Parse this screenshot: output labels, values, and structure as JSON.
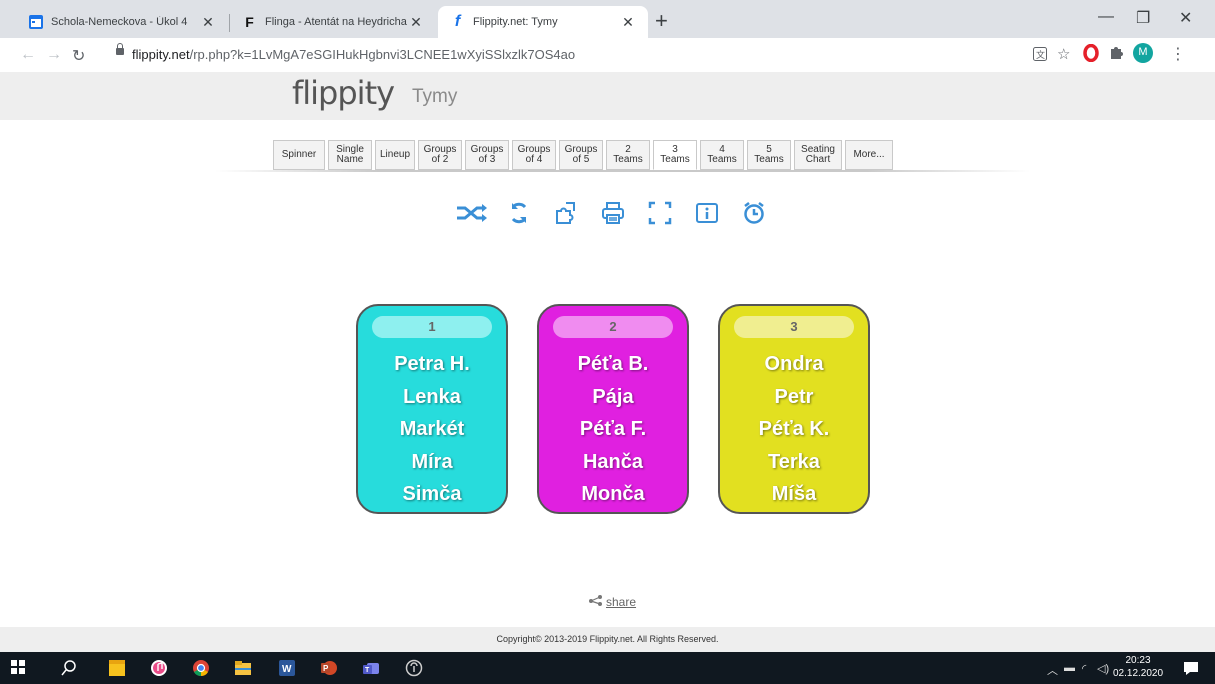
{
  "browser": {
    "tabs": [
      {
        "title": "Schola-Nemeckova - Úkol 4"
      },
      {
        "title": "Flinga - Atentát na Heydricha"
      },
      {
        "title": "Flippity.net: Tymy"
      }
    ],
    "url_host": "flippity.net",
    "url_path": "/rp.php?k=1LvMgA7eSGIHukHgbnvi3LCNEE1wXyiSSlxzlk7OS4ao",
    "profile_initial": "M"
  },
  "page": {
    "logo": "flippity",
    "title": "Tymy",
    "modes": [
      {
        "line1": "Spinner",
        "line2": ""
      },
      {
        "line1": "Single",
        "line2": "Name"
      },
      {
        "line1": "Lineup",
        "line2": ""
      },
      {
        "line1": "Groups",
        "line2": "of 2"
      },
      {
        "line1": "Groups",
        "line2": "of 3"
      },
      {
        "line1": "Groups",
        "line2": "of 4"
      },
      {
        "line1": "Groups",
        "line2": "of 5"
      },
      {
        "line1": "2",
        "line2": "Teams"
      },
      {
        "line1": "3",
        "line2": "Teams"
      },
      {
        "line1": "4",
        "line2": "Teams"
      },
      {
        "line1": "5",
        "line2": "Teams"
      },
      {
        "line1": "Seating",
        "line2": "Chart"
      },
      {
        "line1": "More...",
        "line2": ""
      }
    ],
    "selected_mode": "3 Teams",
    "teams": [
      {
        "number": "1",
        "color": "#27dcdc",
        "header_color": "#8ef0ef",
        "members": [
          "Petra H.",
          "Lenka",
          "Markét",
          "Míra",
          "Simča"
        ]
      },
      {
        "number": "2",
        "color": "#e020e0",
        "header_color": "#f08cf0",
        "members": [
          "Péťa B.",
          "Pája",
          "Péťa F.",
          "Hanča",
          "Monča"
        ]
      },
      {
        "number": "3",
        "color": "#e2e020",
        "header_color": "#f0ee90",
        "members": [
          "Ondra",
          "Petr",
          "Péťa K.",
          "Terka",
          "Míša"
        ]
      }
    ],
    "share_label": "share",
    "copyright": "Copyright© 2013-2019 Flippity.net. All Rights Reserved.",
    "accent_color": "#3a8fd6"
  },
  "taskbar": {
    "time": "20:23",
    "date": "02.12.2020"
  }
}
